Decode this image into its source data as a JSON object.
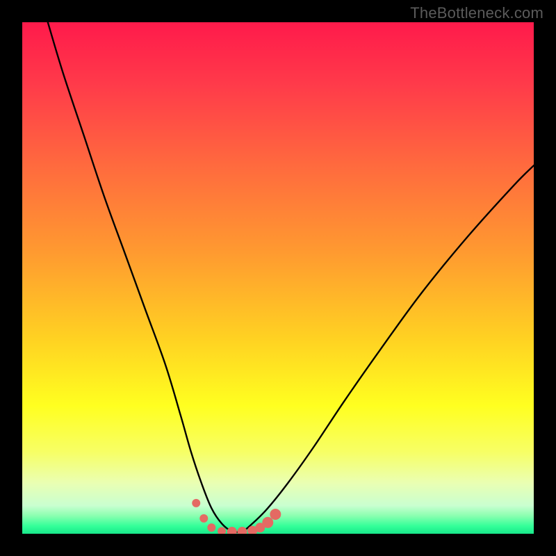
{
  "watermark": "TheBottleneck.com",
  "colors": {
    "black": "#000000",
    "curve_stroke": "#000000",
    "dot_fill": "#e46a63",
    "gradient_stops": [
      {
        "offset": 0.0,
        "color": "#ff1a4b"
      },
      {
        "offset": 0.12,
        "color": "#ff3a4a"
      },
      {
        "offset": 0.28,
        "color": "#ff6a3e"
      },
      {
        "offset": 0.45,
        "color": "#ff9a30"
      },
      {
        "offset": 0.62,
        "color": "#ffd222"
      },
      {
        "offset": 0.75,
        "color": "#ffff20"
      },
      {
        "offset": 0.84,
        "color": "#f7ff65"
      },
      {
        "offset": 0.9,
        "color": "#eaffb2"
      },
      {
        "offset": 0.945,
        "color": "#c9ffd0"
      },
      {
        "offset": 0.965,
        "color": "#8affb0"
      },
      {
        "offset": 0.985,
        "color": "#33ff99"
      },
      {
        "offset": 1.0,
        "color": "#18e88a"
      }
    ]
  },
  "chart_data": {
    "type": "line",
    "title": "",
    "xlabel": "",
    "ylabel": "",
    "xlim": [
      0,
      100
    ],
    "ylim": [
      0,
      100
    ],
    "series": [
      {
        "name": "bottleneck-curve",
        "x": [
          5,
          8,
          12,
          16,
          20,
          24,
          28,
          31,
          33,
          35,
          37,
          39,
          41,
          43,
          45,
          48,
          52,
          57,
          63,
          70,
          78,
          87,
          96,
          100
        ],
        "y": [
          100,
          90,
          78,
          66,
          55,
          44,
          33,
          23,
          16,
          10,
          5,
          2,
          0.5,
          0.5,
          2,
          5,
          10,
          17,
          26,
          36,
          47,
          58,
          68,
          72
        ]
      }
    ],
    "dots": {
      "name": "highlight-dots",
      "x": [
        34.0,
        35.5,
        37.0,
        39.0,
        41.0,
        43.0,
        45.0,
        46.5,
        48.0,
        49.5
      ],
      "y": [
        6.0,
        3.0,
        1.2,
        0.5,
        0.4,
        0.4,
        0.6,
        1.2,
        2.2,
        3.8
      ],
      "r": [
        6,
        6,
        6,
        6,
        7,
        7,
        7,
        7,
        8,
        8
      ]
    },
    "grid": false,
    "legend": false
  }
}
